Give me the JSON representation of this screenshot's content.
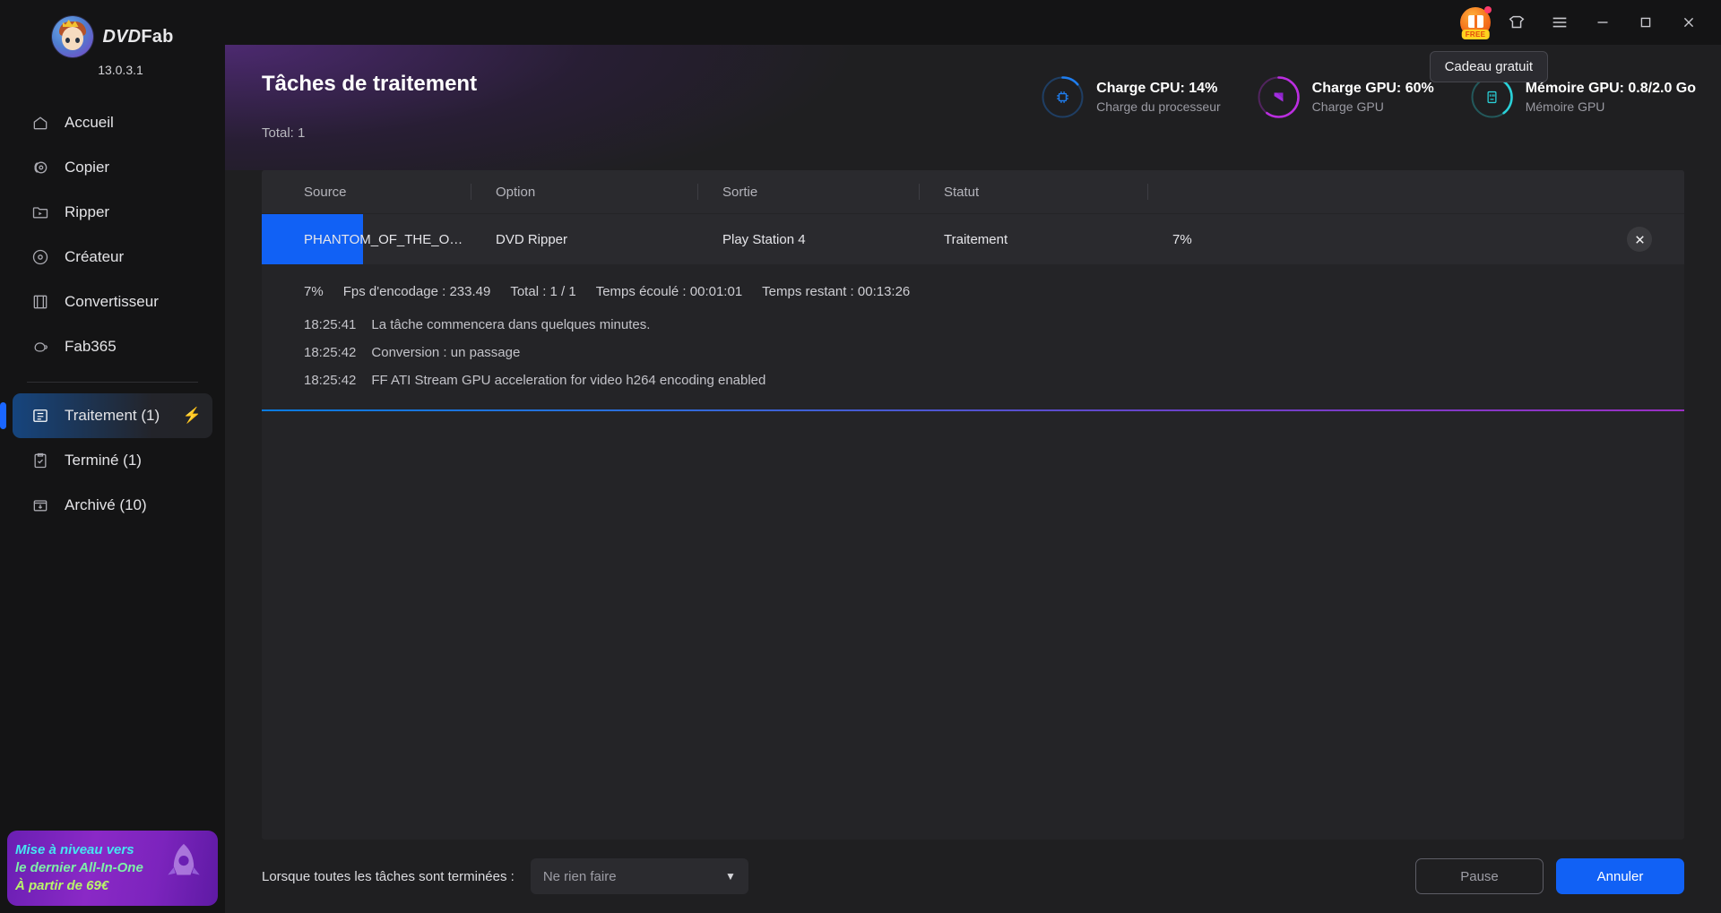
{
  "brand": {
    "name_bold": "DVD",
    "name_light": "Fab",
    "version": "13.0.3.1"
  },
  "titlebar": {
    "gift_badge_label": "FREE",
    "tooltip": "Cadeau gratuit"
  },
  "sidebar": {
    "items": [
      {
        "label": "Accueil",
        "icon": "home-icon"
      },
      {
        "label": "Copier",
        "icon": "disc-copy-icon"
      },
      {
        "label": "Ripper",
        "icon": "folder-play-icon"
      },
      {
        "label": "Créateur",
        "icon": "disc-icon"
      },
      {
        "label": "Convertisseur",
        "icon": "film-icon"
      },
      {
        "label": "Fab365",
        "icon": "fab365-icon"
      }
    ],
    "queue": [
      {
        "label": "Traitement (1)",
        "icon": "task-list-icon",
        "active": true,
        "bolt": "⚡"
      },
      {
        "label": "Terminé (1)",
        "icon": "clipboard-check-icon",
        "active": false
      },
      {
        "label": "Archivé (10)",
        "icon": "archive-icon",
        "active": false
      }
    ],
    "promo": {
      "line1": "Mise à niveau vers",
      "line2": "le dernier All-In-One",
      "line3": "À partir de 69€"
    }
  },
  "header": {
    "title": "Tâches de traitement",
    "total": "Total: 1",
    "stats": [
      {
        "title": "Charge CPU: 14%",
        "subtitle": "Charge du processeur",
        "percent": 14,
        "color": "#1f7ef0",
        "icon": "cpu-icon"
      },
      {
        "title": "Charge GPU: 60%",
        "subtitle": "Charge GPU",
        "percent": 60,
        "color": "#bb2ee0",
        "icon": "amd-icon"
      },
      {
        "title": "Mémoire GPU: 0.8/2.0 Go",
        "subtitle": "Mémoire GPU",
        "percent": 40,
        "color": "#2ad0d8",
        "icon": "memory-icon"
      }
    ]
  },
  "table": {
    "columns": [
      "Source",
      "Option",
      "Sortie",
      "Statut",
      ""
    ],
    "row": {
      "source": "PHANTOM_OF_THE_OPE…",
      "option": "DVD Ripper",
      "sortie": "Play Station 4",
      "statut": "Traitement",
      "progress": "7%",
      "progress_value": 7,
      "close_icon": "close-icon"
    },
    "detail": {
      "stats": [
        "7%",
        "Fps d'encodage : 233.49",
        "Total : 1 / 1",
        "Temps écoulé : 00:01:01",
        "Temps restant : 00:13:26"
      ],
      "log": [
        {
          "time": "18:25:41",
          "message": "La tâche commencera dans quelques minutes."
        },
        {
          "time": "18:25:42",
          "message": "Conversion : un passage"
        },
        {
          "time": "18:25:42",
          "message": "FF ATI Stream GPU acceleration for video h264 encoding enabled"
        }
      ]
    }
  },
  "bottombar": {
    "label": "Lorsque toutes les tâches sont terminées :",
    "select_value": "Ne rien faire",
    "pause_label": "Pause",
    "cancel_label": "Annuler"
  }
}
